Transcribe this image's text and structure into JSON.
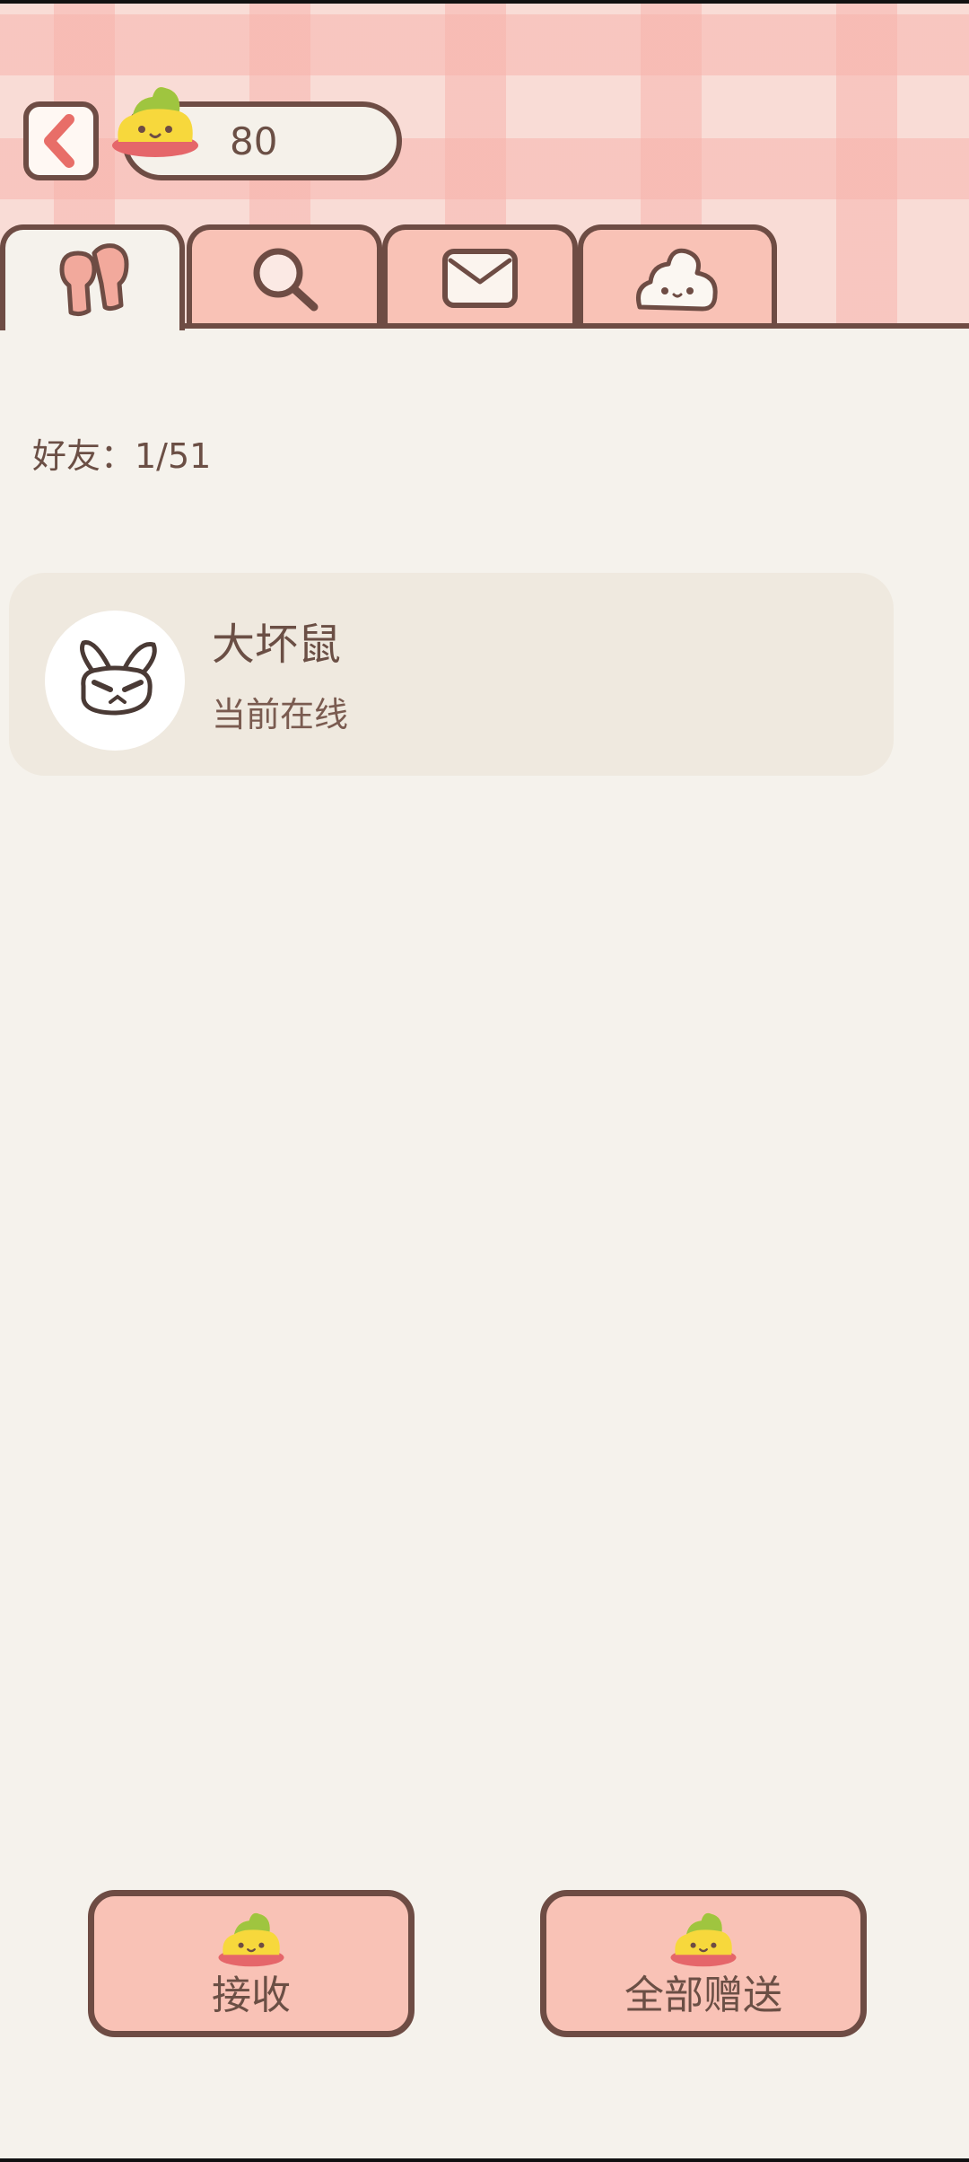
{
  "header": {
    "coins": "80"
  },
  "tabs": [
    {
      "id": "friends",
      "icon": "friends-icon",
      "active": true
    },
    {
      "id": "search",
      "icon": "search-icon",
      "active": false
    },
    {
      "id": "mail",
      "icon": "mail-icon",
      "active": false
    },
    {
      "id": "blob",
      "icon": "blob-icon",
      "active": false
    }
  ],
  "friends": {
    "count_label": "好友：1/51",
    "list": [
      {
        "name": "大坏鼠",
        "status": "当前在线",
        "avatar": "rabbit-avatar-icon"
      }
    ]
  },
  "actions": {
    "receive_label": "接收",
    "gift_all_label": "全部赠送"
  },
  "colors": {
    "accent": "#f9c2b6",
    "outline": "#6e4c44",
    "background": "#f5f2ec",
    "card": "#efe9df",
    "back_arrow": "#e86e68"
  }
}
